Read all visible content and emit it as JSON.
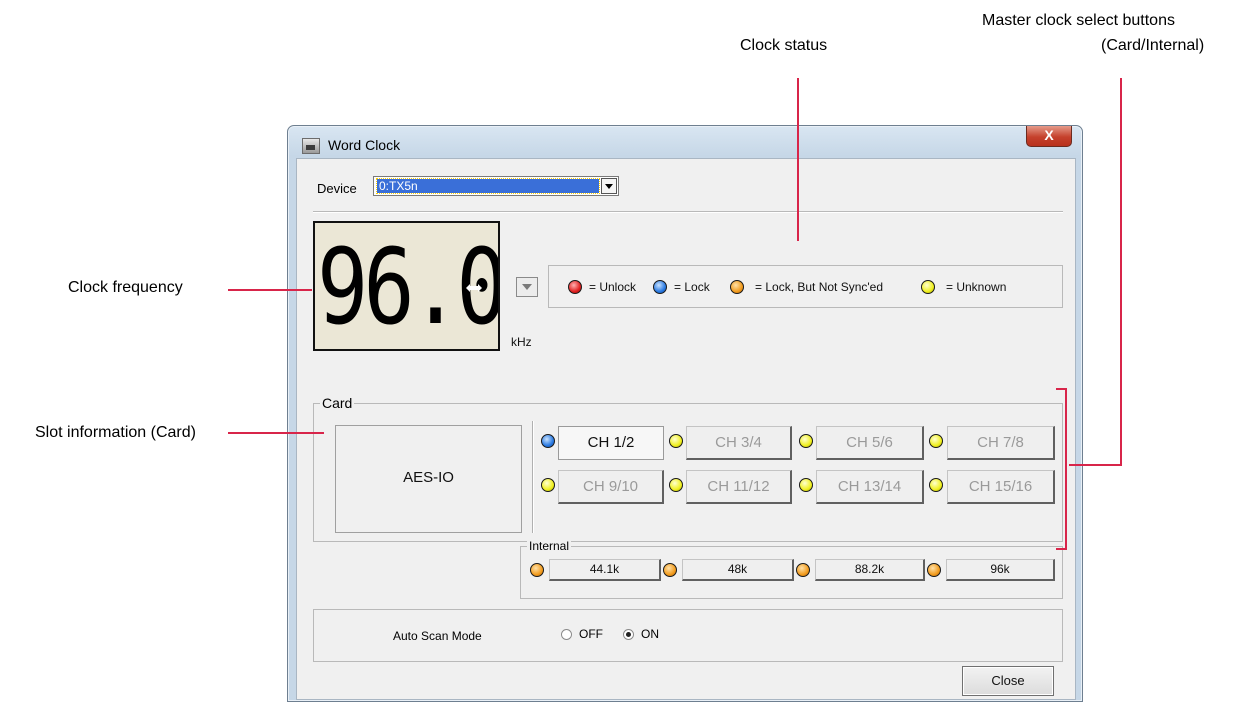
{
  "annotations": {
    "clock_status": "Clock status",
    "master_clock_line1": "Master clock select buttons",
    "master_clock_line2": "(Card/Internal)",
    "clock_frequency": "Clock frequency",
    "slot_information": "Slot information (Card)"
  },
  "window": {
    "title": "Word Clock",
    "close_glyph": "X"
  },
  "device": {
    "label": "Device",
    "value": "0:TX5n"
  },
  "frequency": {
    "value": "96.0",
    "unit": "kHz"
  },
  "legend": [
    {
      "color": "red",
      "text": "= Unlock"
    },
    {
      "color": "blue",
      "text": "= Lock"
    },
    {
      "color": "orange",
      "text": "= Lock, But Not Sync'ed"
    },
    {
      "color": "yellow",
      "text": "= Unknown"
    }
  ],
  "card": {
    "group_title": "Card",
    "slot_name": "AES-IO",
    "channels": [
      {
        "label": "CH 1/2",
        "status": "blue",
        "active": true
      },
      {
        "label": "CH 3/4",
        "status": "yellow",
        "active": false
      },
      {
        "label": "CH 5/6",
        "status": "yellow",
        "active": false
      },
      {
        "label": "CH 7/8",
        "status": "yellow",
        "active": false
      },
      {
        "label": "CH 9/10",
        "status": "yellow",
        "active": false
      },
      {
        "label": "CH 11/12",
        "status": "yellow",
        "active": false
      },
      {
        "label": "CH 13/14",
        "status": "yellow",
        "active": false
      },
      {
        "label": "CH 15/16",
        "status": "yellow",
        "active": false
      }
    ]
  },
  "internal": {
    "group_title": "Internal",
    "rates": [
      {
        "label": "44.1k",
        "status": "orange"
      },
      {
        "label": "48k",
        "status": "orange"
      },
      {
        "label": "88.2k",
        "status": "orange"
      },
      {
        "label": "96k",
        "status": "orange"
      }
    ]
  },
  "auto_scan": {
    "label": "Auto Scan Mode",
    "off_label": "OFF",
    "on_label": "ON",
    "selected": "ON"
  },
  "buttons": {
    "close_label": "Close"
  },
  "colors": {
    "annotation_line": "#d8254a",
    "red": "#e02020",
    "blue": "#2a7ae2",
    "orange": "#f29c1e",
    "yellow": "#f0f020"
  }
}
